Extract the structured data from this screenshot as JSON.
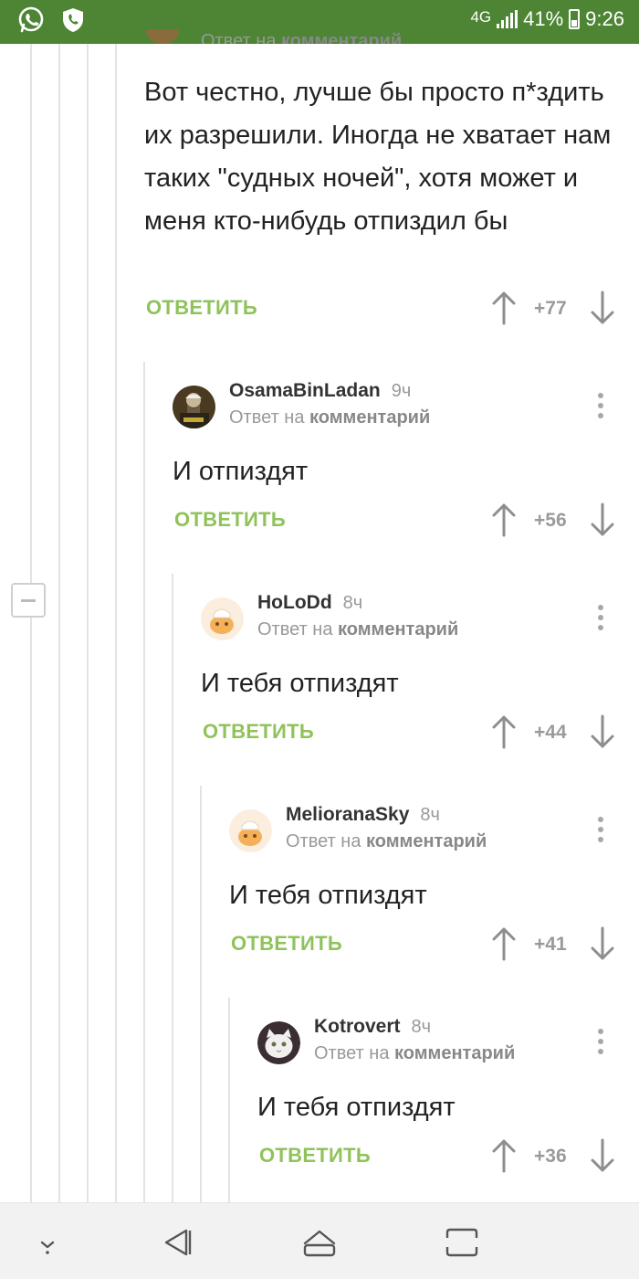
{
  "status_bar": {
    "network": "4G",
    "battery": "41%",
    "time": "9:26",
    "icons": [
      "whatsapp-icon",
      "phone-shield-icon",
      "signal-icon",
      "battery-icon"
    ]
  },
  "top_comment": {
    "header_cut": "Ответ на комментарий",
    "header_prefix": "Ответ на ",
    "header_link": "комментарий",
    "body": "Вот честно, лучше бы просто п*здить их разрешили. Иногда не хватает нам таких \"судных ночей\", хотя может и меня кто-нибудь отпиздил бы",
    "reply_label": "ОТВЕТИТЬ",
    "score": "+77"
  },
  "comments": [
    {
      "author": "OsamaBinLadan",
      "time": "9ч",
      "reply_prefix": "Ответ на ",
      "reply_link": "комментарий",
      "body": "И отпиздят",
      "reply_label": "ОТВЕТИТЬ",
      "score": "+56"
    },
    {
      "author": "HoLoDd",
      "time": "8ч",
      "reply_prefix": "Ответ на ",
      "reply_link": "комментарий",
      "body": "И тебя отпиздят",
      "reply_label": "ОТВЕТИТЬ",
      "score": "+44"
    },
    {
      "author": "MelioranaSky",
      "time": "8ч",
      "reply_prefix": "Ответ на ",
      "reply_link": "комментарий",
      "body": "И тебя отпиздят",
      "reply_label": "ОТВЕТИТЬ",
      "score": "+41"
    },
    {
      "author": "Kotrovert",
      "time": "8ч",
      "reply_prefix": "Ответ на ",
      "reply_link": "комментарий",
      "body": "И тебя отпиздят",
      "reply_label": "ОТВЕТИТЬ",
      "score": "+36"
    }
  ],
  "colors": {
    "status_bar": "#4d8535",
    "reply_accent": "#8fc35a",
    "muted": "#999999"
  },
  "nav_bar": {
    "icons": [
      "keyboard-hide-icon",
      "back-icon",
      "home-icon",
      "recents-icon"
    ]
  }
}
